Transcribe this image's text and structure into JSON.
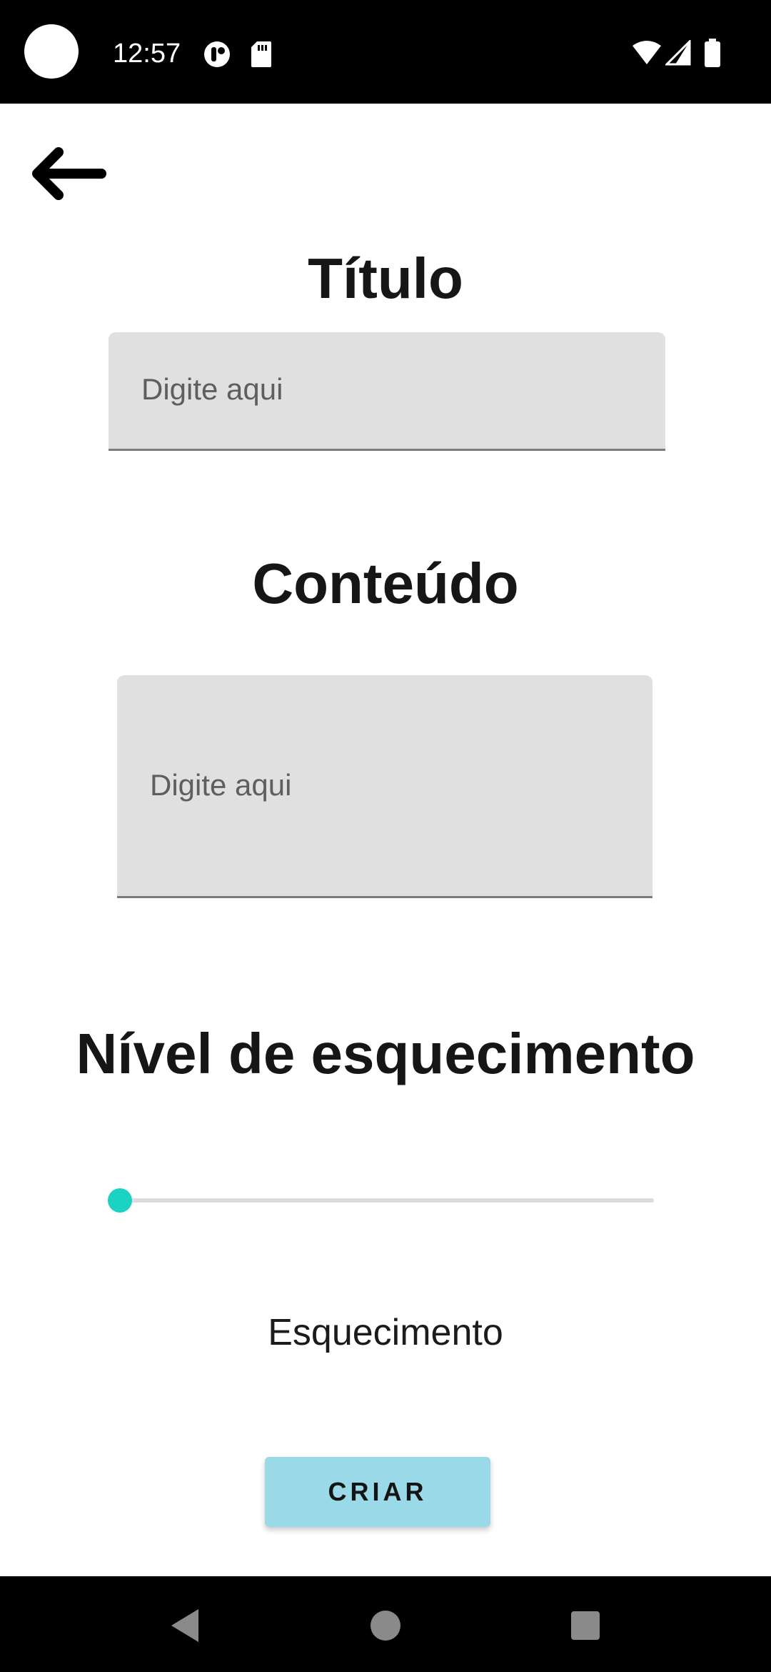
{
  "status_bar": {
    "time": "12:57"
  },
  "form": {
    "title": {
      "heading": "Título",
      "placeholder": "Digite aqui"
    },
    "content": {
      "heading": "Conteúdo",
      "placeholder": "Digite aqui"
    },
    "forgetting_level": {
      "heading": "Nível de esquecimento",
      "slider_value_fraction": 0.0,
      "caption": "Esquecimento"
    },
    "create_button_label": "CRIAR"
  },
  "colors": {
    "slider_accent": "#1ad3c2",
    "button_background": "#99d9e8",
    "field_background": "#e0e0e0"
  },
  "icons": {
    "back": "arrow-left-icon",
    "nav_back": "triangle-back-icon",
    "nav_home": "circle-home-icon",
    "nav_recents": "square-recents-icon"
  }
}
